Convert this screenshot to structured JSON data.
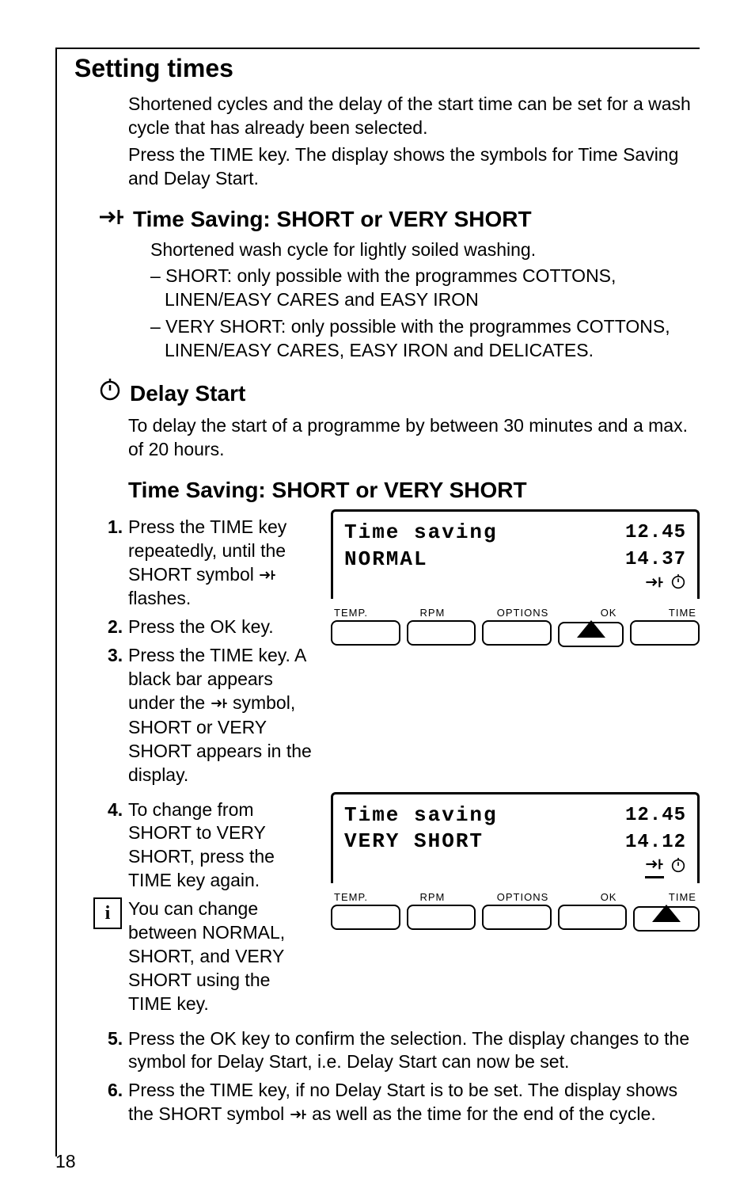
{
  "page_number": "18",
  "h1": "Setting times",
  "intro_p1": "Shortened cycles and the delay of the start time can be set for a wash cycle that has already been selected.",
  "intro_p2": "Press the TIME key. The display shows the symbols for Time Saving and Delay Start.",
  "h2_timesaving": "Time Saving: SHORT or VERY SHORT",
  "timesaving_sub": "Shortened wash cycle for lightly soiled washing.",
  "timesaving_d1": "– SHORT: only possible with the programmes COTTONS, LINEN/EASY CARES and EASY IRON",
  "timesaving_d2": "– VERY SHORT: only possible with the programmes COTTONS, LINEN/EASY CARES, EASY IRON and DELICATES.",
  "h2_delay": "Delay Start",
  "delay_p": "To delay the start of a programme by between 30 minutes and a max. of 20 hours.",
  "h2_proc": "Time Saving: SHORT or VERY SHORT",
  "steps": {
    "s1a": "Press the TIME key repeatedly, until the SHORT symbol ",
    "s1b": " flashes.",
    "s2": "Press the OK key.",
    "s3a": "Press the TIME key. A black bar appears under the ",
    "s3b": " symbol, SHORT or VERY SHORT appears in the display.",
    "s4": "To change from SHORT to VERY SHORT, press the TIME key again.",
    "s5": "Press the OK key to confirm the selection. The display changes to the symbol for Delay Start, i.e. Delay Start can now be set.",
    "s6a": "Press the TIME key, if no Delay Start is to be set. The display shows the SHORT symbol ",
    "s6b": " as well as the time for the end of the cycle."
  },
  "info_note": "You can change between NORMAL, SHORT, and VERY SHORT using the TIME key.",
  "panel1": {
    "line1": "Time saving",
    "line2": "NORMAL",
    "time1": "12.45",
    "time2": "14.37"
  },
  "panel2": {
    "line1": "Time saving",
    "line2": "VERY SHORT",
    "time1": "12.45",
    "time2": "14.12"
  },
  "btn_labels": {
    "temp": "TEMP.",
    "rpm": "RPM",
    "options": "OPTIONS",
    "ok": "OK",
    "time": "TIME"
  },
  "icons": {
    "short": "short-icon",
    "delay": "clock-icon",
    "info": "i"
  }
}
